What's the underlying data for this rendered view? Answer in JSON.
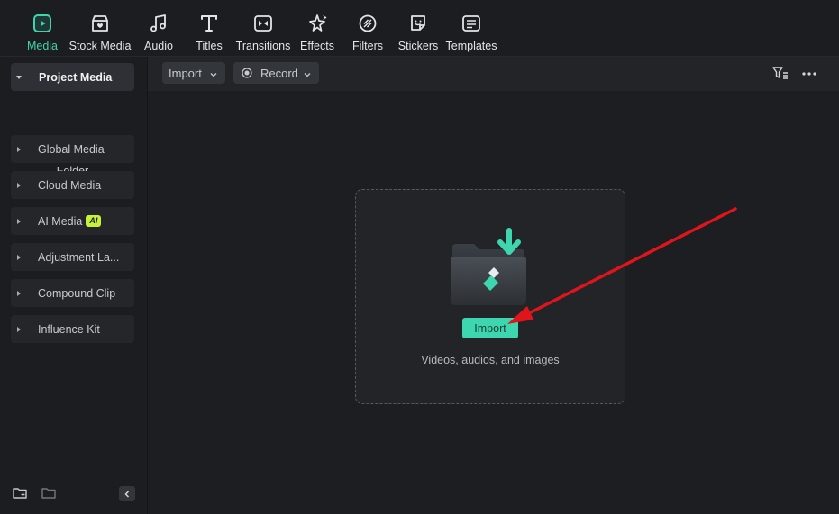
{
  "tabs": [
    {
      "label": "Media",
      "icon": "media-icon",
      "active": true
    },
    {
      "label": "Stock Media",
      "icon": "stock-media-icon"
    },
    {
      "label": "Audio",
      "icon": "music-note-icon"
    },
    {
      "label": "Titles",
      "icon": "text-t-icon"
    },
    {
      "label": "Transitions",
      "icon": "transitions-icon"
    },
    {
      "label": "Effects",
      "icon": "effects-sparkle-icon"
    },
    {
      "label": "Filters",
      "icon": "filters-icon"
    },
    {
      "label": "Stickers",
      "icon": "sticker-icon"
    },
    {
      "label": "Templates",
      "icon": "templates-icon"
    }
  ],
  "sidebar": {
    "items": [
      {
        "label": "Project Media",
        "expanded": true
      },
      {
        "label": "Folder"
      },
      {
        "label": "Global Media"
      },
      {
        "label": "Cloud Media"
      },
      {
        "label": "AI Media",
        "badge": "AI"
      },
      {
        "label": "Adjustment La..."
      },
      {
        "label": "Compound Clip"
      },
      {
        "label": "Influence Kit"
      }
    ],
    "bottom_icons": [
      "new-folder-icon",
      "folder-outline-icon",
      "collapse-left-icon"
    ]
  },
  "toolbar": {
    "import_label": "Import",
    "record_label": "Record",
    "filter_icon": "filter-list-icon",
    "more_icon": "more-horizontal-icon"
  },
  "dropzone": {
    "button_label": "Import",
    "hint": "Videos, audios, and images",
    "illustration_icon": "folder-import-icon"
  },
  "colors": {
    "accent": "#3dd6ae",
    "annotation_arrow": "#e0141b",
    "ai_badge": "#c7f23a"
  }
}
